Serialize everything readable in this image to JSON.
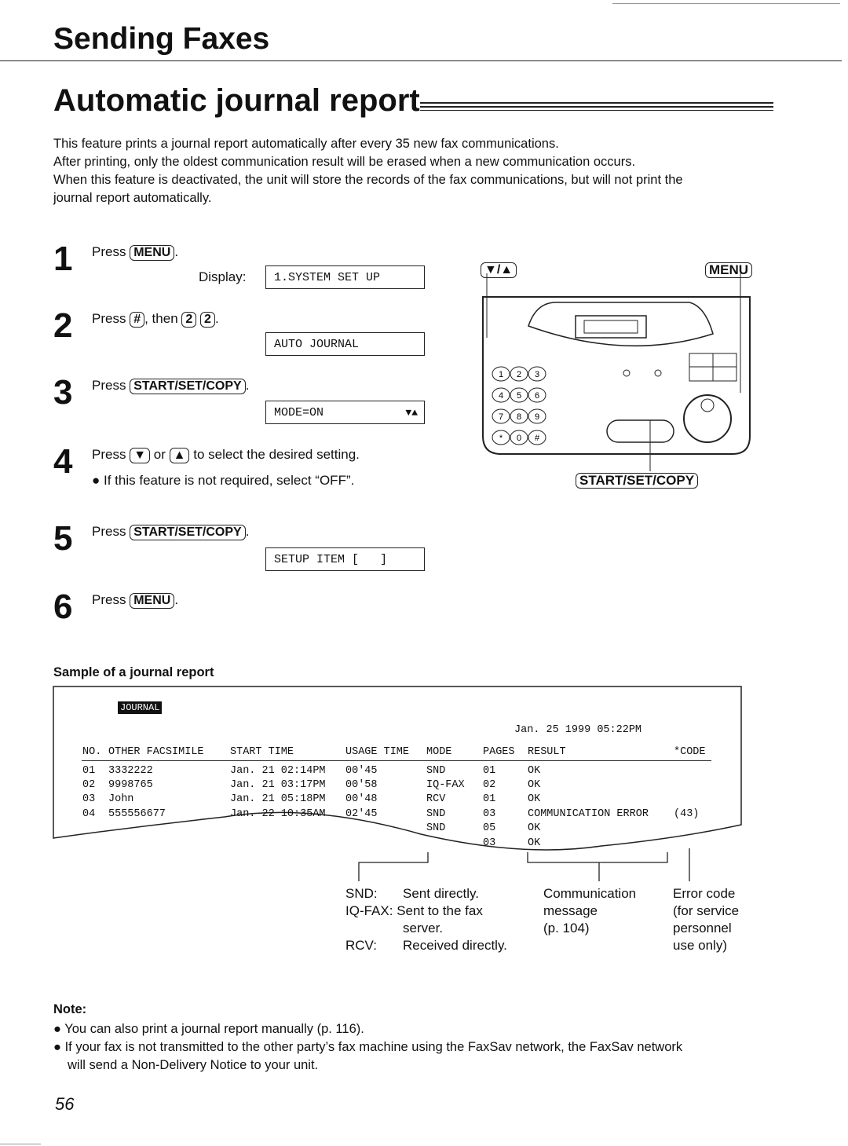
{
  "header": {
    "section": "Sending Faxes",
    "title": "Automatic journal report"
  },
  "intro": [
    "This feature prints a journal report automatically after every 35 new fax communications.",
    "After printing, only the oldest communication result will be erased when a new communication occurs.",
    "When this feature is deactivated, the unit will store the records of the fax communications, but will not print the",
    "journal report automatically."
  ],
  "steps": [
    {
      "num": "1",
      "pre": "Press",
      "key": "MENU",
      "post": ".",
      "display_label": "Display:",
      "display": "1.SYSTEM SET UP"
    },
    {
      "num": "2",
      "pre": "Press",
      "key": "#",
      "mid": ", then",
      "keys2": [
        "2",
        "2"
      ],
      "post": ".",
      "display": "AUTO JOURNAL"
    },
    {
      "num": "3",
      "pre": "Press",
      "key": "START/SET/COPY",
      "post": ".",
      "display": "MODE=ON",
      "display_arrows": "▼▲"
    },
    {
      "num": "4",
      "pre": "Press",
      "key": "▼",
      "mid": "or",
      "key2": "▲",
      "post": "to select the desired setting.",
      "bullet": "If this feature is not required, select “OFF”."
    },
    {
      "num": "5",
      "pre": "Press",
      "key": "START/SET/COPY",
      "post": ".",
      "display": "SETUP ITEM [   ]"
    },
    {
      "num": "6",
      "pre": "Press",
      "key": "MENU",
      "post": "."
    }
  ],
  "illustration": {
    "label_arrows": "▼/▲",
    "label_menu": "MENU",
    "label_start": "START/SET/COPY",
    "keypad": [
      "1",
      "2",
      "3",
      "4",
      "5",
      "6",
      "7",
      "8",
      "9",
      "*",
      "0",
      "#"
    ]
  },
  "sample": {
    "heading": "Sample of a journal report",
    "tag": "JOURNAL",
    "datetime": "Jan. 25 1999 05:22PM",
    "columns": [
      "NO.",
      "OTHER FACSIMILE",
      "START TIME",
      "USAGE TIME",
      "MODE",
      "PAGES",
      "RESULT",
      "*CODE"
    ],
    "rows": [
      [
        "01",
        "3332222",
        "Jan. 21 02:14PM",
        "00'45",
        "SND",
        "01",
        "OK",
        ""
      ],
      [
        "02",
        "9998765",
        "Jan. 21 03:17PM",
        "00'58",
        "IQ-FAX",
        "02",
        "OK",
        ""
      ],
      [
        "03",
        "John",
        "Jan. 21 05:18PM",
        "00'48",
        "RCV",
        "01",
        "OK",
        ""
      ],
      [
        "04",
        "555556677",
        "Jan. 22 10:35AM",
        "02'45",
        "SND",
        "03",
        "COMMUNICATION ERROR",
        "(43)"
      ],
      [
        "",
        "",
        "",
        "",
        "SND",
        "05",
        "OK",
        ""
      ],
      [
        "",
        "",
        "",
        "",
        "",
        "03",
        "OK",
        ""
      ]
    ],
    "annotations": {
      "mode": [
        "SND:",
        "Sent directly.",
        "IQ-FAX:",
        "Sent to the fax",
        "server.",
        "RCV:",
        "Received directly."
      ],
      "message": [
        "Communication",
        "message",
        "(p. 104)"
      ],
      "code": [
        "Error code",
        "(for service",
        "personnel",
        "use only)"
      ]
    }
  },
  "note": {
    "heading": "Note:",
    "items": [
      "You can also print a journal report manually (p. 116).",
      "If your fax is not transmitted to the other party’s fax machine using the FaxSav network, the FaxSav network",
      "will send a Non-Delivery Notice to your unit."
    ]
  },
  "page_number": "56"
}
